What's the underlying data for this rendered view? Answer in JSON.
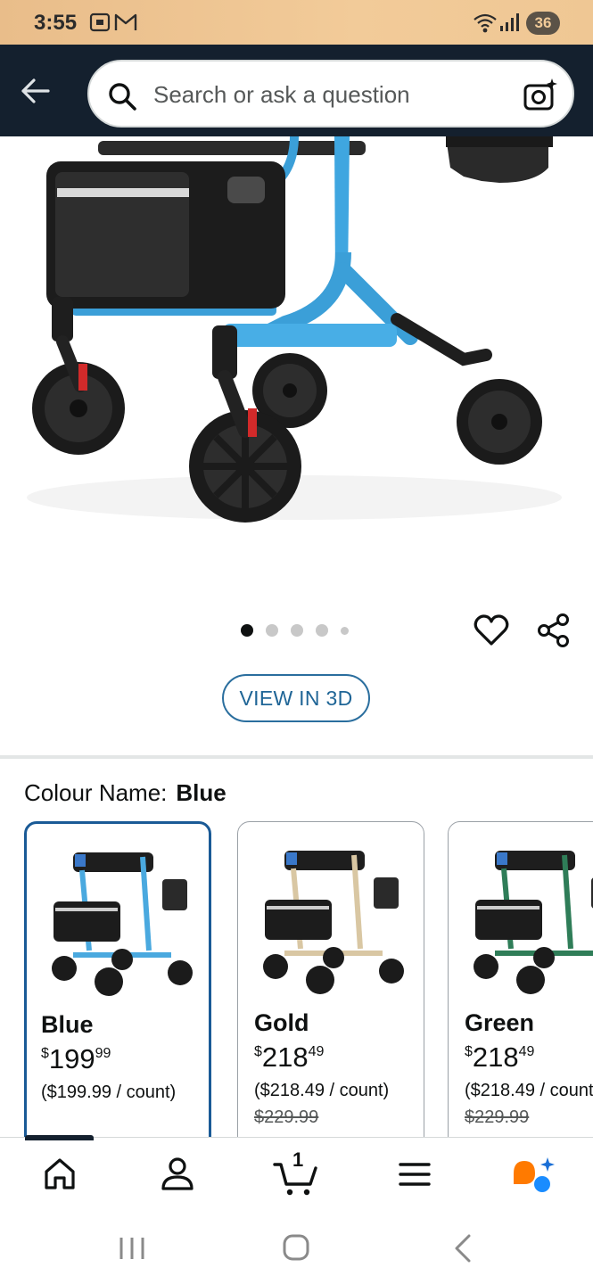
{
  "status_bar": {
    "time": "3:55",
    "battery": "36",
    "icons": [
      "screenshot-icon",
      "gmail-icon",
      "wifi-icon",
      "signal-icon"
    ]
  },
  "search": {
    "placeholder": "Search or ask a question",
    "icons": [
      "back-arrow-icon",
      "search-icon",
      "camera-search-icon"
    ]
  },
  "gallery": {
    "image_count": 5,
    "active_index": 0,
    "view_3d_label": "VIEW IN 3D"
  },
  "variation": {
    "label": "Colour Name:",
    "selected": "Blue",
    "options": [
      {
        "name": "Blue",
        "price_whole": "199",
        "price_fraction": "99",
        "currency": "$",
        "unit_price": "($199.99 / count)",
        "list_price": "",
        "frame_color": "#4aa9df"
      },
      {
        "name": "Gold",
        "price_whole": "218",
        "price_fraction": "49",
        "currency": "$",
        "unit_price": "($218.49 / count)",
        "list_price": "$229.99",
        "frame_color": "#d9c7a3"
      },
      {
        "name": "Green",
        "price_whole": "218",
        "price_fraction": "49",
        "currency": "$",
        "unit_price": "($218.49 / count)",
        "list_price": "$229.99",
        "frame_color": "#2f7d58"
      }
    ]
  },
  "bottom_nav": {
    "items": [
      "home-icon",
      "account-icon",
      "cart-icon",
      "menu-icon",
      "rufus-ai-icon"
    ],
    "cart_count": "1",
    "active": "home"
  },
  "colors": {
    "header_bg": "#14202e",
    "status_bg": "#f2cb99",
    "link_blue": "#1f6596",
    "selected_border": "#1a5a96",
    "rufus_orange": "#ff7a00",
    "rufus_blue": "#1a8cff"
  }
}
